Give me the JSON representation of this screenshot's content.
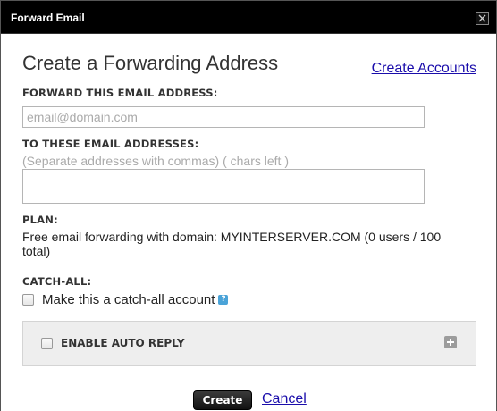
{
  "dialog": {
    "title": "Forward Email",
    "heading": "Create a Forwarding Address",
    "create_accounts_link": "Create Accounts"
  },
  "forward_field": {
    "label": "FORWARD THIS EMAIL ADDRESS:",
    "placeholder": "email@domain.com",
    "value": ""
  },
  "to_field": {
    "label": "TO THESE EMAIL ADDRESSES:",
    "hint": "(Separate addresses with commas) ( chars left )",
    "value": ""
  },
  "plan": {
    "label": "PLAN:",
    "text": "Free email forwarding with domain: MYINTERSERVER.COM (0 users / 100 total)"
  },
  "catch_all": {
    "label": "CATCH-ALL:",
    "checkbox_label": "Make this a catch-all account",
    "checked": false,
    "help_icon": "help-icon"
  },
  "auto_reply": {
    "label": "ENABLE AUTO REPLY",
    "checked": false,
    "expand_icon": "plus-icon"
  },
  "actions": {
    "create_label": "Create",
    "cancel_label": "Cancel"
  },
  "colors": {
    "titlebar": "#000000",
    "link": "#1a0dab",
    "panel": "#eeeeee",
    "help_icon": "#4aa3d8"
  }
}
